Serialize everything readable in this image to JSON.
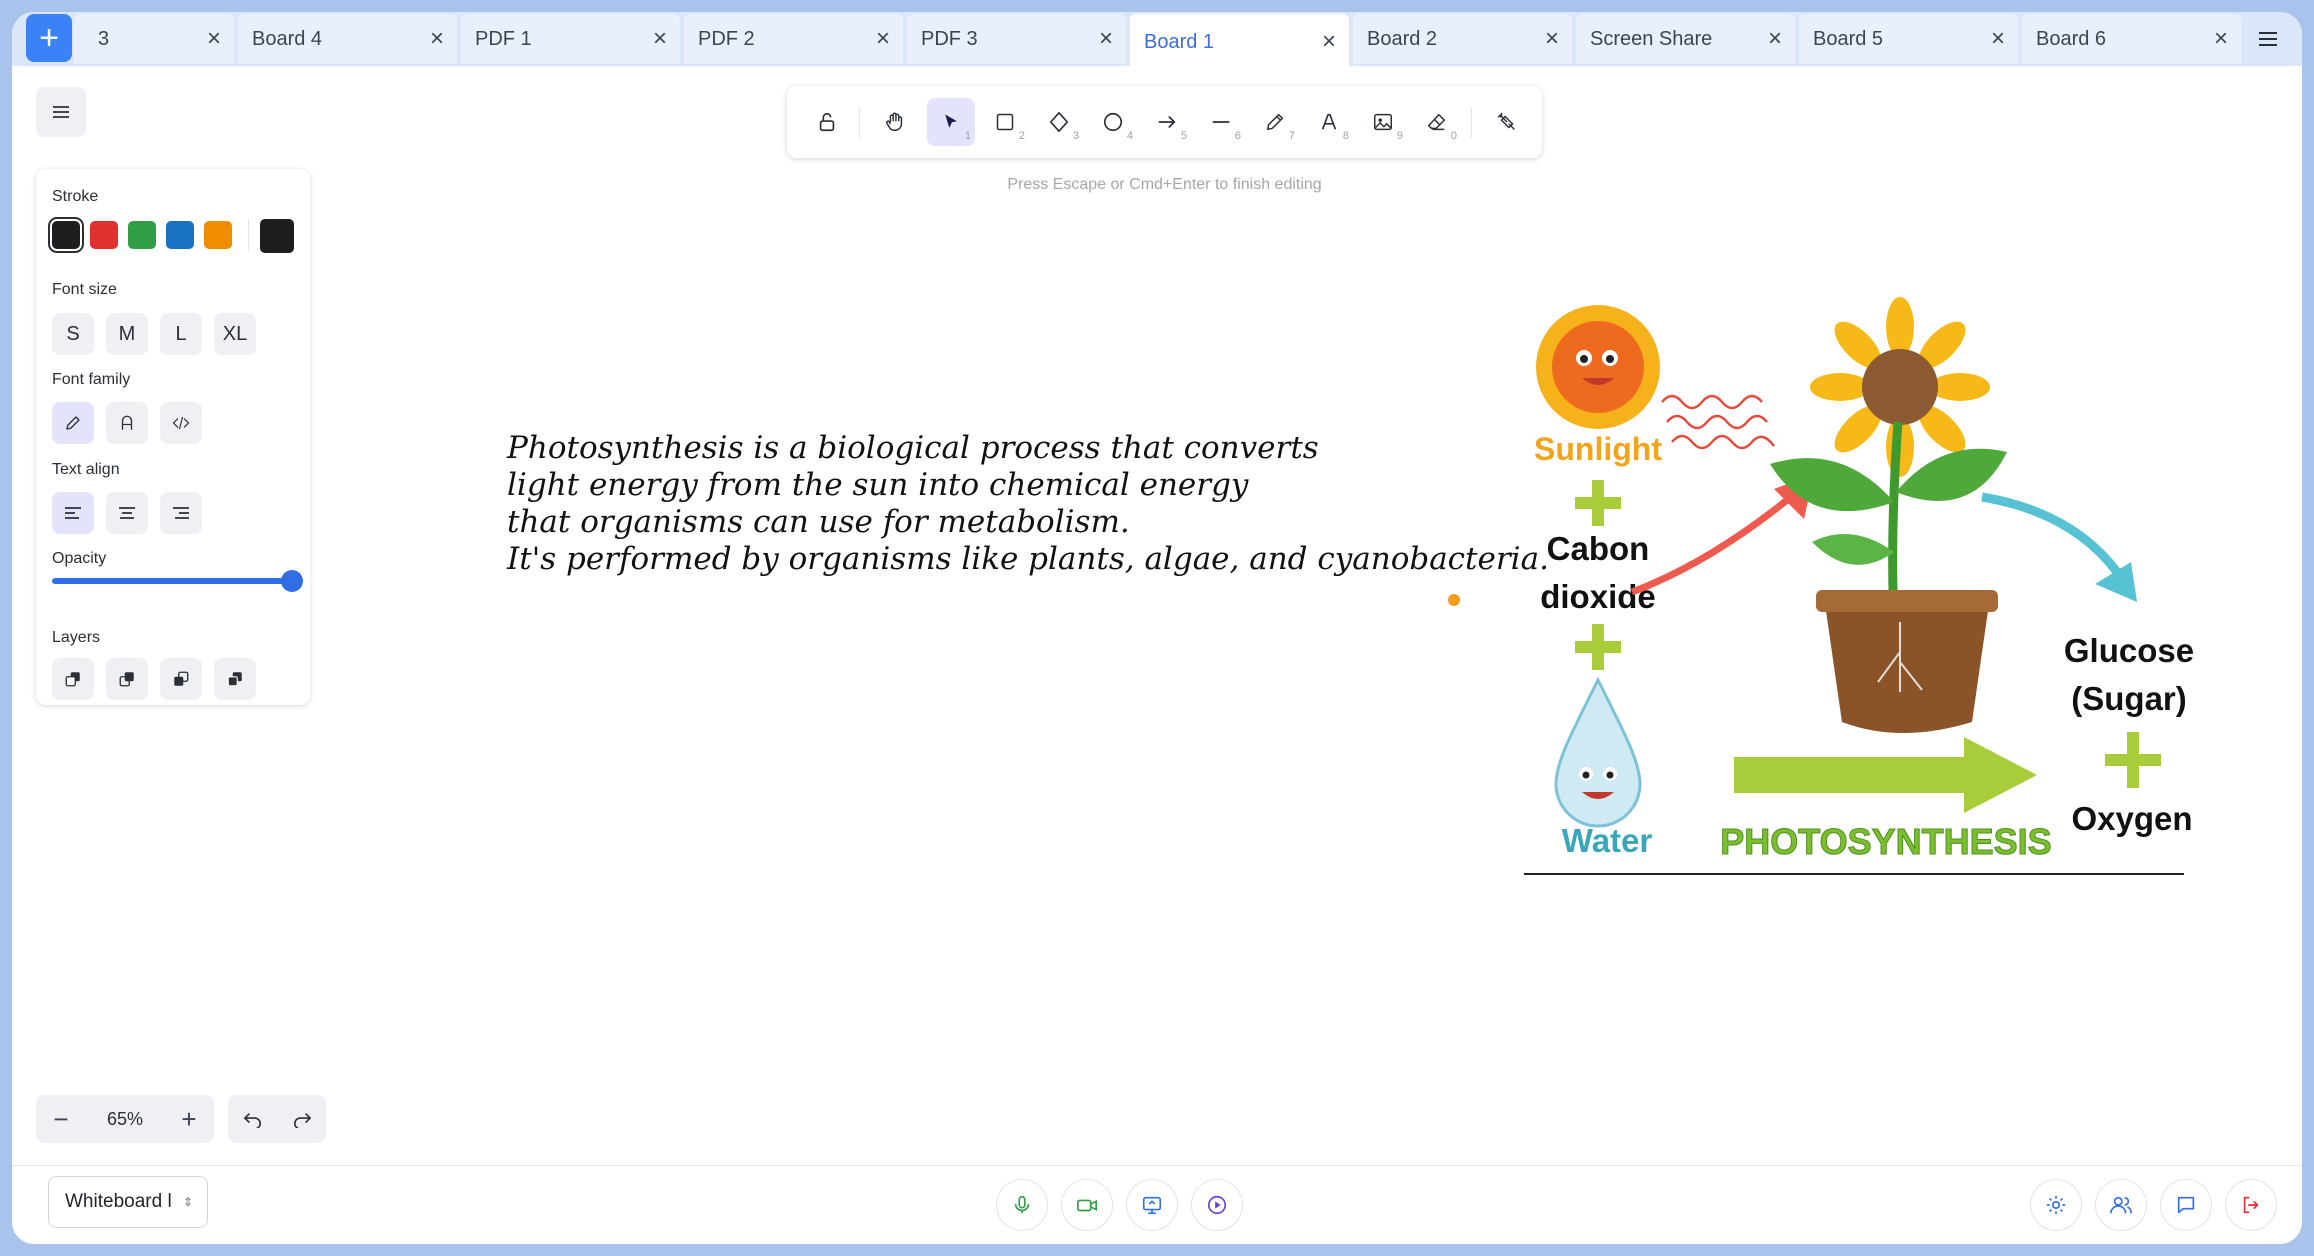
{
  "tabs": [
    {
      "label": "3"
    },
    {
      "label": "Board 4"
    },
    {
      "label": "PDF 1"
    },
    {
      "label": "PDF 2"
    },
    {
      "label": "PDF 3"
    },
    {
      "label": "Board 1"
    },
    {
      "label": "Board 2"
    },
    {
      "label": "Screen Share"
    },
    {
      "label": "Board 5"
    },
    {
      "label": "Board 6"
    }
  ],
  "active_tab": "Board 1",
  "toolbar": {
    "tools": [
      {
        "icon": "lock-icon",
        "key": ""
      },
      {
        "icon": "hand-icon",
        "key": ""
      },
      {
        "icon": "pointer-icon",
        "key": "1"
      },
      {
        "icon": "rectangle-icon",
        "key": "2"
      },
      {
        "icon": "diamond-icon",
        "key": "3"
      },
      {
        "icon": "ellipse-icon",
        "key": "4"
      },
      {
        "icon": "arrow-icon",
        "key": "5"
      },
      {
        "icon": "line-icon",
        "key": "6"
      },
      {
        "icon": "pencil-icon",
        "key": "7"
      },
      {
        "icon": "text-icon",
        "key": "8"
      },
      {
        "icon": "image-icon",
        "key": "9"
      },
      {
        "icon": "eraser-icon",
        "key": "0"
      },
      {
        "icon": "laser-icon",
        "key": ""
      }
    ],
    "hint": "Press Escape or Cmd+Enter to finish editing"
  },
  "panel": {
    "stroke_label": "Stroke",
    "stroke_colors": [
      "#1e1e1e",
      "#e03131",
      "#2f9e44",
      "#1971c2",
      "#f08c00"
    ],
    "stroke_current": "#1e1e1e",
    "font_size_label": "Font size",
    "font_sizes": [
      "S",
      "M",
      "L",
      "XL"
    ],
    "font_family_label": "Font family",
    "text_align_label": "Text align",
    "opacity_label": "Opacity",
    "opacity_value": 100,
    "layers_label": "Layers"
  },
  "zoom": {
    "minus": "−",
    "value": "65%",
    "plus": "+"
  },
  "canvas_text": [
    "Photosynthesis is a biological process that converts",
    "light energy from the sun into chemical energy",
    "that organisms can use for metabolism.",
    "It's performed by organisms like plants, algae, and cyanobacteria."
  ],
  "diagram": {
    "sunlight": "Sunlight",
    "co2_line1": "Cabon",
    "co2_line2": "dioxide",
    "water": "Water",
    "glucose_line1": "Glucose",
    "glucose_line2": "(Sugar)",
    "oxygen": "Oxygen",
    "banner": "PHOTOSYNTHESIS",
    "colors": {
      "sunlight": "#f2a51a",
      "water": "#3aa6b9",
      "banner": "#7cbf2e",
      "plus": "#a8cc3a"
    }
  },
  "bottom": {
    "board_select": "Whiteboard l",
    "controls": [
      "mic-icon",
      "video-icon",
      "screen-share-icon",
      "record-icon"
    ],
    "right_controls": [
      "settings-icon",
      "participants-icon",
      "chat-icon",
      "leave-icon"
    ]
  }
}
